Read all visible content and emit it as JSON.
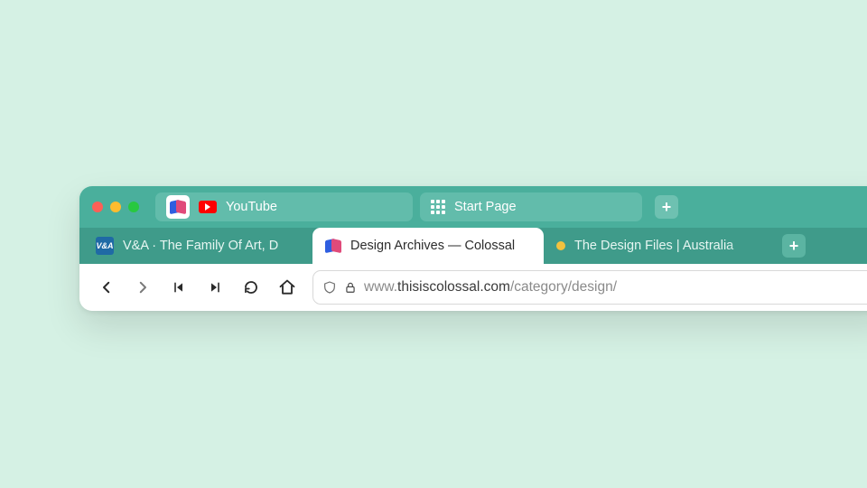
{
  "colors": {
    "page_bg": "#d5f1e4",
    "chrome_top": "#4aaf9c",
    "chrome_tabs": "#3f9b8a",
    "accent_light": "#62bcab",
    "traffic_red": "#ff5f57",
    "traffic_yellow": "#febc2e",
    "traffic_green": "#28c840"
  },
  "workspaces": [
    {
      "icon": "colossal",
      "secondary_icon": "youtube",
      "label": "YouTube"
    },
    {
      "icon": "grid",
      "label": "Start Page"
    }
  ],
  "tabs": [
    {
      "favicon": "va",
      "title": "V&A · The Family Of Art, D",
      "active": false
    },
    {
      "favicon": "colossal",
      "title": "Design Archives — Colossal",
      "active": true
    },
    {
      "favicon": "dot",
      "title": "The Design Files | Australia",
      "active": false
    }
  ],
  "url": {
    "prefix": "www.",
    "host": "thisiscolossal.com",
    "path": "/category/design/"
  }
}
